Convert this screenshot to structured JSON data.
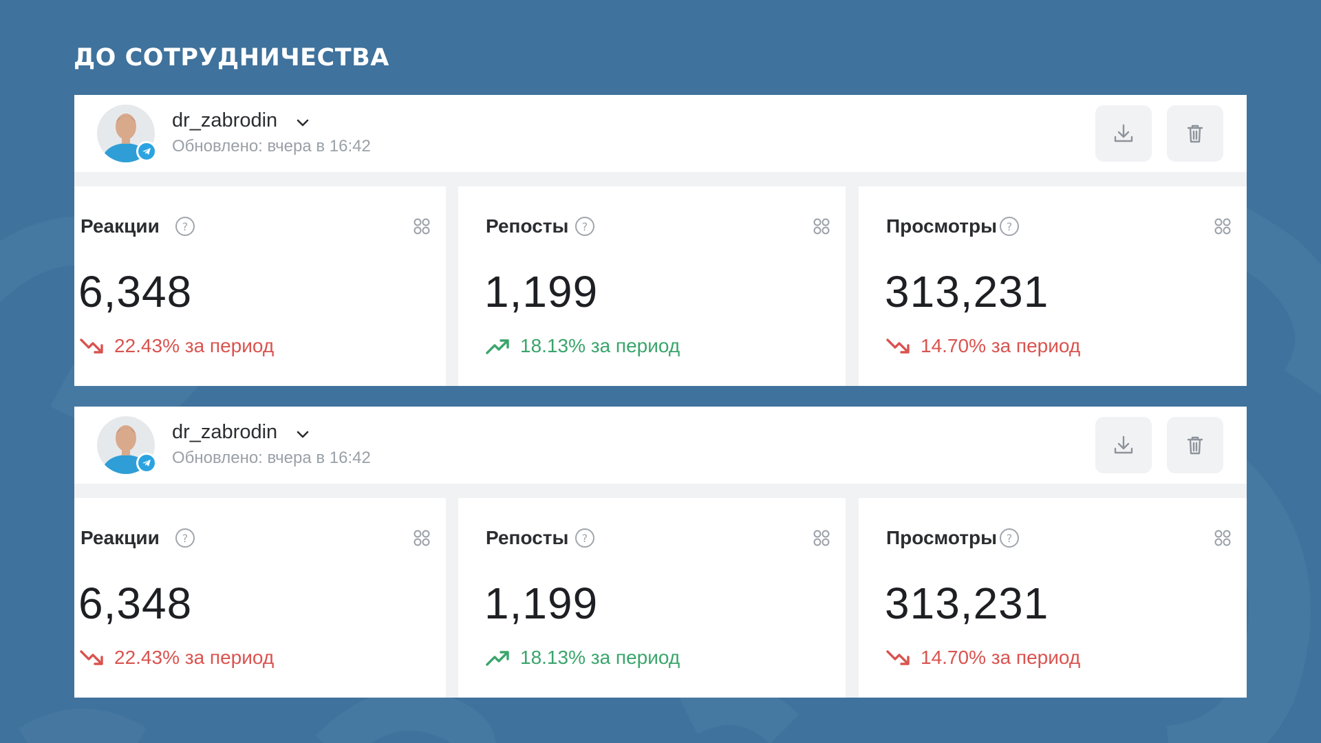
{
  "slide": {
    "title": "ДО СОТРУДНИЧЕСТВА"
  },
  "colors": {
    "background": "#3f729c",
    "negative": "#d9534f",
    "positive": "#3aa56c"
  },
  "panels": [
    {
      "account": "dr_zabrodin",
      "updated": "Обновлено: вчера в 16:42",
      "metrics": [
        {
          "label": "Реакции",
          "value": "6,348",
          "change": "22.43% за период",
          "direction": "down"
        },
        {
          "label": "Репосты",
          "value": "1,199",
          "change": "18.13% за период",
          "direction": "up"
        },
        {
          "label": "Просмотры",
          "value": "313,231",
          "change": "14.70% за период",
          "direction": "down"
        }
      ]
    },
    {
      "account": "dr_zabrodin",
      "updated": "Обновлено: вчера в 16:42",
      "metrics": [
        {
          "label": "Реакции",
          "value": "6,348",
          "change": "22.43% за период",
          "direction": "down"
        },
        {
          "label": "Репосты",
          "value": "1,199",
          "change": "18.13% за период",
          "direction": "up"
        },
        {
          "label": "Просмотры",
          "value": "313,231",
          "change": "14.70% за период",
          "direction": "down"
        }
      ]
    }
  ]
}
